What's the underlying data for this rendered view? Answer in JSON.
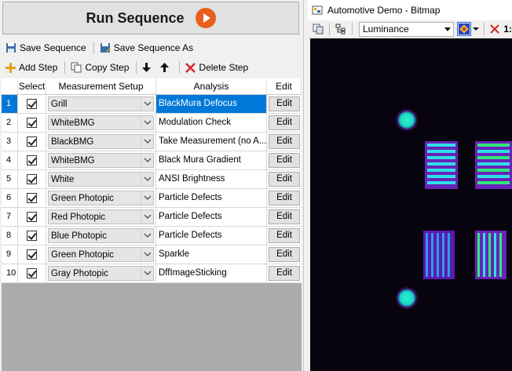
{
  "left_panel": {
    "run_button_label": "Run Sequence",
    "toolbar1": {
      "save": "Save Sequence",
      "save_as": "Save Sequence As"
    },
    "toolbar2": {
      "add": "Add Step",
      "copy": "Copy Step",
      "delete": "Delete Step"
    },
    "columns": [
      "Select",
      "Measurement Setup",
      "Analysis",
      "Edit"
    ],
    "rows": [
      {
        "num": "1",
        "setup": "Grill",
        "analysis": "BlackMura Defocus",
        "edit": "Edit",
        "selected": true
      },
      {
        "num": "2",
        "setup": "WhiteBMG",
        "analysis": "Modulation Check",
        "edit": "Edit"
      },
      {
        "num": "3",
        "setup": "BlackBMG",
        "analysis": "Take Measurement (no A...",
        "edit": "Edit"
      },
      {
        "num": "4",
        "setup": "WhiteBMG",
        "analysis": "Black Mura Gradient",
        "edit": "Edit"
      },
      {
        "num": "5",
        "setup": "White",
        "analysis": "ANSI Brightness",
        "edit": "Edit"
      },
      {
        "num": "6",
        "setup": "Green Photopic",
        "analysis": "Particle Defects",
        "edit": "Edit"
      },
      {
        "num": "7",
        "setup": "Red Photopic",
        "analysis": "Particle Defects",
        "edit": "Edit"
      },
      {
        "num": "8",
        "setup": "Blue Photopic",
        "analysis": "Particle Defects",
        "edit": "Edit"
      },
      {
        "num": "9",
        "setup": "Green Photopic",
        "analysis": "Sparkle",
        "edit": "Edit"
      },
      {
        "num": "10",
        "setup": "Gray Photopic",
        "analysis": "DffImageSticking",
        "edit": "Edit"
      }
    ]
  },
  "right_panel": {
    "title": "Automotive Demo - Bitmap",
    "colorspace": "Luminance",
    "zoom_label": "1:"
  },
  "colors": {
    "accent": "#0078d7",
    "run_icon": "#e8601c",
    "image_bg": "#07040f"
  }
}
